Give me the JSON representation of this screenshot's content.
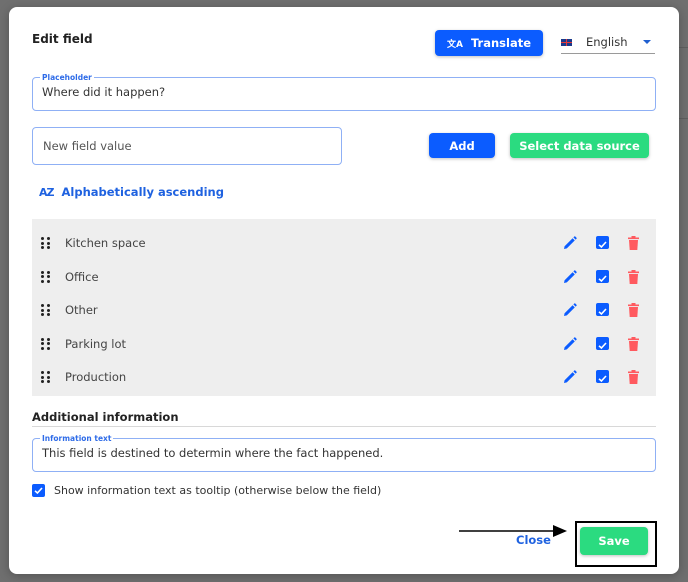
{
  "dialog": {
    "title": "Edit field",
    "translate_label": "Translate",
    "language": {
      "selected": "English",
      "flag": "uk-flag-icon"
    },
    "placeholder_field": {
      "legend": "Placeholder",
      "value": "Where did it happen?"
    },
    "new_value_input": {
      "placeholder": "New field value",
      "value": ""
    },
    "add_label": "Add",
    "select_data_source_label": "Select data source",
    "sort_label": "Alphabetically ascending",
    "sort_icon": "sort-az-icon",
    "items": [
      {
        "label": "Kitchen space",
        "checked": true
      },
      {
        "label": "Office",
        "checked": true
      },
      {
        "label": "Other",
        "checked": true
      },
      {
        "label": "Parking lot",
        "checked": true
      },
      {
        "label": "Production",
        "checked": true
      }
    ],
    "additional_info_title": "Additional information",
    "info_field": {
      "legend": "Information text",
      "value": "This field is destined to determin where the fact happened."
    },
    "tooltip_checkbox": {
      "label": "Show information text as tooltip (otherwise below the field)",
      "checked": true
    },
    "close_label": "Close",
    "save_label": "Save"
  },
  "colors": {
    "primary_blue": "#0b5cff",
    "green": "#2bdb80",
    "delete_red": "#ff5a5f",
    "link_blue": "#1f62e0"
  }
}
